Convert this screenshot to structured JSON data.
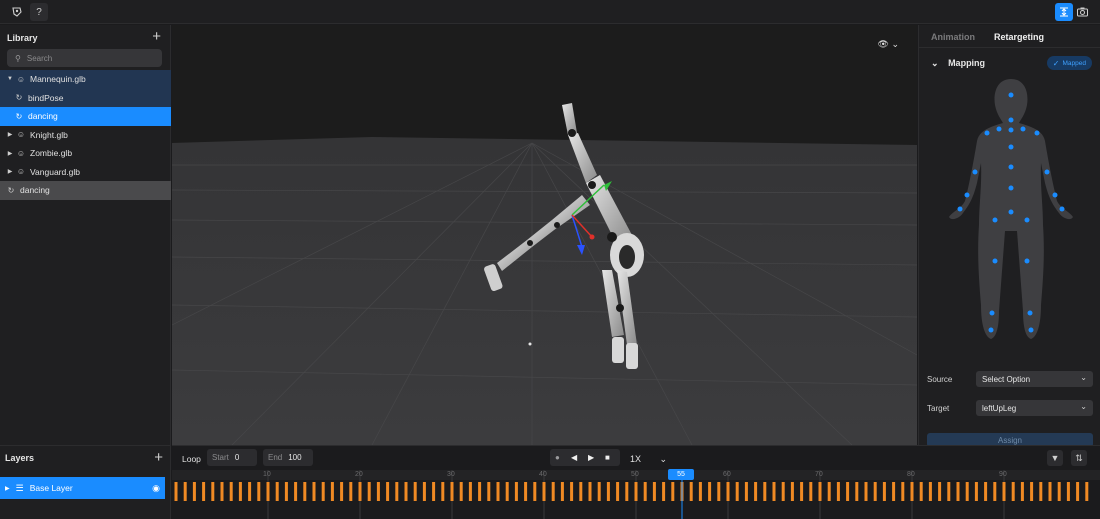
{
  "library": {
    "title": "Library",
    "search_placeholder": "Search",
    "items": [
      {
        "label": "Mannequin.glb",
        "type": "model",
        "expanded": true
      },
      {
        "label": "bindPose",
        "type": "animation"
      },
      {
        "label": "dancing",
        "type": "animation",
        "selected": true
      },
      {
        "label": "Knight.glb",
        "type": "model"
      },
      {
        "label": "Zombie.glb",
        "type": "model"
      },
      {
        "label": "Vanguard.glb",
        "type": "model"
      },
      {
        "label": "dancing",
        "type": "animation"
      }
    ]
  },
  "right_panel": {
    "tabs": [
      "Animation",
      "Retargeting"
    ],
    "active_tab": "Retargeting",
    "mapping_title": "Mapping",
    "mapped_badge": "Mapped",
    "source_label": "Source",
    "source_value": "Select Option",
    "target_label": "Target",
    "target_value": "leftUpLeg",
    "assign_label": "Assign"
  },
  "layers": {
    "title": "Layers",
    "items": [
      {
        "label": "Base Layer",
        "visible": true
      }
    ]
  },
  "timeline": {
    "loop_label": "Loop",
    "start_label": "Start",
    "start_value": "0",
    "end_label": "End",
    "end_value": "100",
    "speed": "1X",
    "current_frame": "55",
    "ruler_labels": [
      "10",
      "20",
      "30",
      "40",
      "50",
      "60",
      "70",
      "80",
      "90"
    ]
  },
  "colors": {
    "accent": "#1a8cff",
    "keyframe": "#f08a24",
    "joint": "#1a8cff"
  }
}
